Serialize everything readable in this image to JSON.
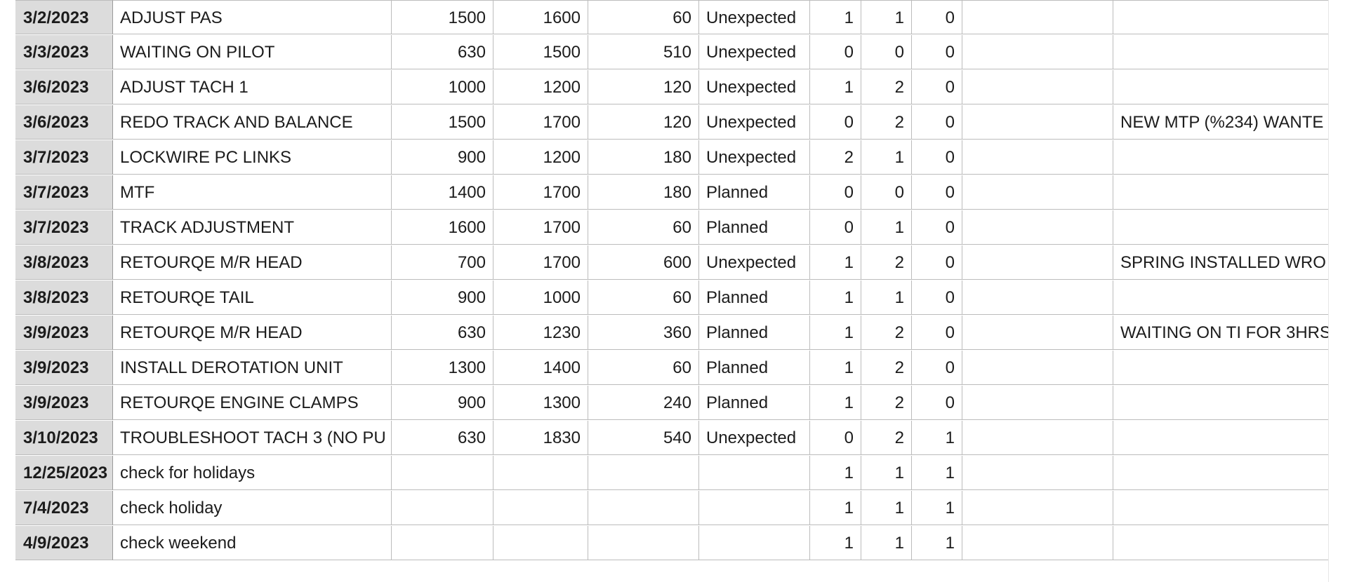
{
  "rows": [
    {
      "date": "3/2/2023",
      "task": "ADJUST PAS",
      "start": "1500",
      "end": "1600",
      "minutes": "60",
      "type": "Unexpected",
      "a": "1",
      "b": "1",
      "c": "0",
      "blank": "",
      "note": ""
    },
    {
      "date": "3/3/2023",
      "task": "WAITING ON PILOT",
      "start": "630",
      "end": "1500",
      "minutes": "510",
      "type": "Unexpected",
      "a": "0",
      "b": "0",
      "c": "0",
      "blank": "",
      "note": ""
    },
    {
      "date": "3/6/2023",
      "task": "ADJUST TACH 1",
      "start": "1000",
      "end": "1200",
      "minutes": "120",
      "type": "Unexpected",
      "a": "1",
      "b": "2",
      "c": "0",
      "blank": "",
      "note": ""
    },
    {
      "date": "3/6/2023",
      "task": "REDO TRACK AND BALANCE",
      "start": "1500",
      "end": "1700",
      "minutes": "120",
      "type": "Unexpected",
      "a": "0",
      "b": "2",
      "c": "0",
      "blank": "",
      "note": "NEW MTP (%234) WANTE"
    },
    {
      "date": "3/7/2023",
      "task": "LOCKWIRE PC LINKS",
      "start": "900",
      "end": "1200",
      "minutes": "180",
      "type": "Unexpected",
      "a": "2",
      "b": "1",
      "c": "0",
      "blank": "",
      "note": ""
    },
    {
      "date": "3/7/2023",
      "task": "MTF",
      "start": "1400",
      "end": "1700",
      "minutes": "180",
      "type": "Planned",
      "a": "0",
      "b": "0",
      "c": "0",
      "blank": "",
      "note": ""
    },
    {
      "date": "3/7/2023",
      "task": "TRACK ADJUSTMENT",
      "start": "1600",
      "end": "1700",
      "minutes": "60",
      "type": "Planned",
      "a": "0",
      "b": "1",
      "c": "0",
      "blank": "",
      "note": ""
    },
    {
      "date": "3/8/2023",
      "task": "RETOURQE M/R HEAD",
      "start": "700",
      "end": "1700",
      "minutes": "600",
      "type": "Unexpected",
      "a": "1",
      "b": "2",
      "c": "0",
      "blank": "",
      "note": "SPRING INSTALLED WRO"
    },
    {
      "date": "3/8/2023",
      "task": "RETOURQE TAIL",
      "start": "900",
      "end": "1000",
      "minutes": "60",
      "type": "Planned",
      "a": "1",
      "b": "1",
      "c": "0",
      "blank": "",
      "note": ""
    },
    {
      "date": "3/9/2023",
      "task": "RETOURQE M/R HEAD",
      "start": "630",
      "end": "1230",
      "minutes": "360",
      "type": "Planned",
      "a": "1",
      "b": "2",
      "c": "0",
      "blank": "",
      "note": "WAITING ON TI FOR 3HRS"
    },
    {
      "date": "3/9/2023",
      "task": "INSTALL DEROTATION UNIT",
      "start": "1300",
      "end": "1400",
      "minutes": "60",
      "type": "Planned",
      "a": "1",
      "b": "2",
      "c": "0",
      "blank": "",
      "note": ""
    },
    {
      "date": "3/9/2023",
      "task": "RETOURQE ENGINE CLAMPS",
      "start": "900",
      "end": "1300",
      "minutes": "240",
      "type": "Planned",
      "a": "1",
      "b": "2",
      "c": "0",
      "blank": "",
      "note": ""
    },
    {
      "date": "3/10/2023",
      "task": "TROUBLESHOOT TACH 3 (NO PU",
      "start": "630",
      "end": "1830",
      "minutes": "540",
      "type": "Unexpected",
      "a": "0",
      "b": "2",
      "c": "1",
      "blank": "",
      "note": ""
    },
    {
      "date": "12/25/2023",
      "task": "check for holidays",
      "start": "",
      "end": "",
      "minutes": "",
      "type": "",
      "a": "1",
      "b": "1",
      "c": "1",
      "blank": "",
      "note": ""
    },
    {
      "date": "7/4/2023",
      "task": "check holiday",
      "start": "",
      "end": "",
      "minutes": "",
      "type": "",
      "a": "1",
      "b": "1",
      "c": "1",
      "blank": "",
      "note": ""
    },
    {
      "date": "4/9/2023",
      "task": "check weekend",
      "start": "",
      "end": "",
      "minutes": "",
      "type": "",
      "a": "1",
      "b": "1",
      "c": "1",
      "blank": "",
      "note": ""
    }
  ],
  "colors": {
    "header_fill": "#dcdcdc",
    "grid": "#bcbcbc"
  }
}
